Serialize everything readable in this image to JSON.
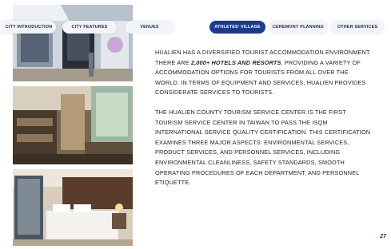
{
  "nav": {
    "tabs": [
      {
        "label": "CITY INTRODUCTION",
        "active": false
      },
      {
        "label": "CITY FEATURES",
        "active": false
      },
      {
        "label": "VENUES",
        "active": false
      },
      {
        "label": "ATHLETES' VILLAGE",
        "active": true
      },
      {
        "label": "CEREMONY PLANNING",
        "active": false
      },
      {
        "label": "OTHER SERVICES",
        "active": false
      }
    ]
  },
  "content": {
    "p1_part1": "HUALIEN HAS A DIVERSIFIED TOURIST ACCOMMODATION ENVIRONMENT. THERE ARE ",
    "p1_emphasis": "2,000+ HOTELS AND RESORTS",
    "p1_part2": ", PROVIDING A VARIETY OF ACCOMMODATION OPTIONS FOR TOURISTS FROM ALL OVER THE WORLD. IN TERMS OF EQUIPMENT AND SERVICES, HUALIEN PROVIDES CONSIDERATE SERVICES TO TOURISTS.",
    "p2": "THE HUALIEN COUNTY TOURISM SERVICE CENTER IS THE FIRST TOURISM SERVICE CENTER IN TAIWAN TO PASS THE ISQM INTERNATIONAL SERVICE QUALITY CERTIFICATION. THIS CERTIFICATION EXAMINES THREE MAJOR ASPECTS: ENVIRONMENTAL SERVICES, PRODUCT SERVICES, AND PERSONNEL SERVICES, INCLUDING ENVIRONMENTAL CLEANLINESS, SAFETY STANDARDS, SMOOTH OPERATING PROCEDURES OF EACH DEPARTMENT, AND PERSONNEL ETIQUETTE."
  },
  "page_number": "27",
  "colors": {
    "accent": "#1e3a8a",
    "text": "#20242f"
  }
}
